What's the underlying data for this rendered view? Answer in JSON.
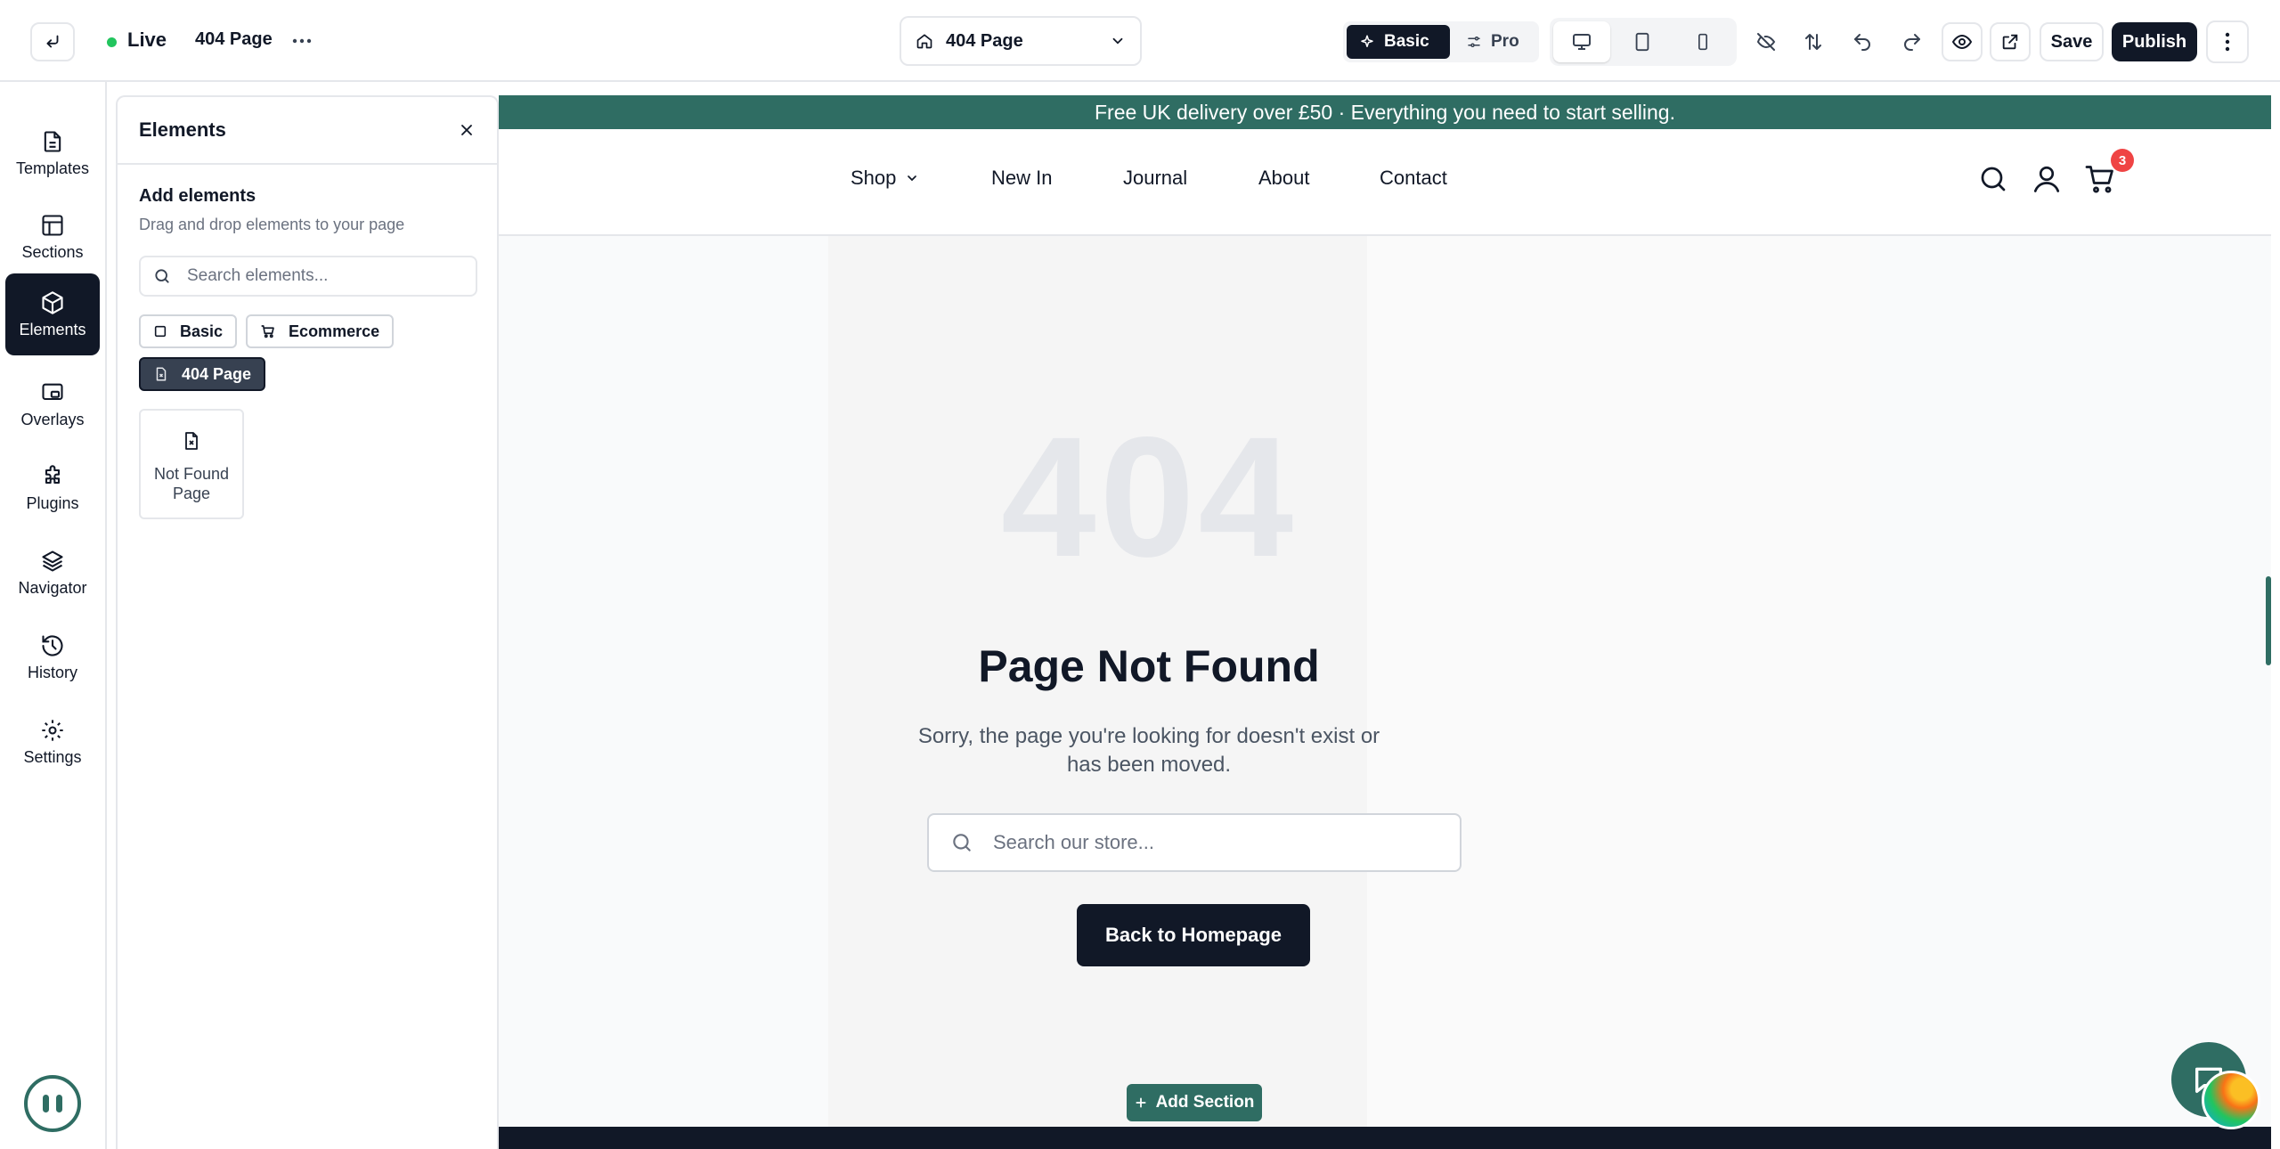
{
  "topbar": {
    "status_label": "Live",
    "page_name": "404 Page",
    "page_selector": "404 Page",
    "mode_basic": "Basic",
    "mode_pro": "Pro",
    "save_label": "Save",
    "publish_label": "Publish"
  },
  "rail": {
    "items": [
      {
        "label": "Templates",
        "icon": "file-icon"
      },
      {
        "label": "Sections",
        "icon": "layout-icon"
      },
      {
        "label": "Elements",
        "icon": "cube-icon"
      },
      {
        "label": "Overlays",
        "icon": "overlay-icon"
      },
      {
        "label": "Plugins",
        "icon": "puzzle-icon"
      },
      {
        "label": "Navigator",
        "icon": "layers-icon"
      },
      {
        "label": "History",
        "icon": "history-icon"
      },
      {
        "label": "Settings",
        "icon": "gear-icon"
      }
    ],
    "active": "Elements"
  },
  "panel": {
    "title": "Elements",
    "add_title": "Add elements",
    "add_subtitle": "Drag and drop elements to your page",
    "search_placeholder": "Search elements...",
    "chips": [
      {
        "label": "Basic",
        "active": false
      },
      {
        "label": "Ecommerce",
        "active": false
      },
      {
        "label": "404 Page",
        "active": true
      }
    ],
    "card_label": "Not Found Page"
  },
  "store": {
    "announcement": "Free UK delivery over £50 · Everything you need to start selling.",
    "nav": [
      "Shop",
      "New In",
      "Journal",
      "About",
      "Contact"
    ],
    "cart_count": "3",
    "code": "404",
    "title": "Page Not Found",
    "subtitle": "Sorry, the page you're looking for doesn't exist or has been moved.",
    "search_placeholder": "Search our store...",
    "home_button": "Back to Homepage",
    "add_section": "Add Section"
  },
  "colors": {
    "brand": "#2f6d63",
    "dark": "#111827",
    "badge": "#ef4444",
    "live": "#22c55e"
  }
}
